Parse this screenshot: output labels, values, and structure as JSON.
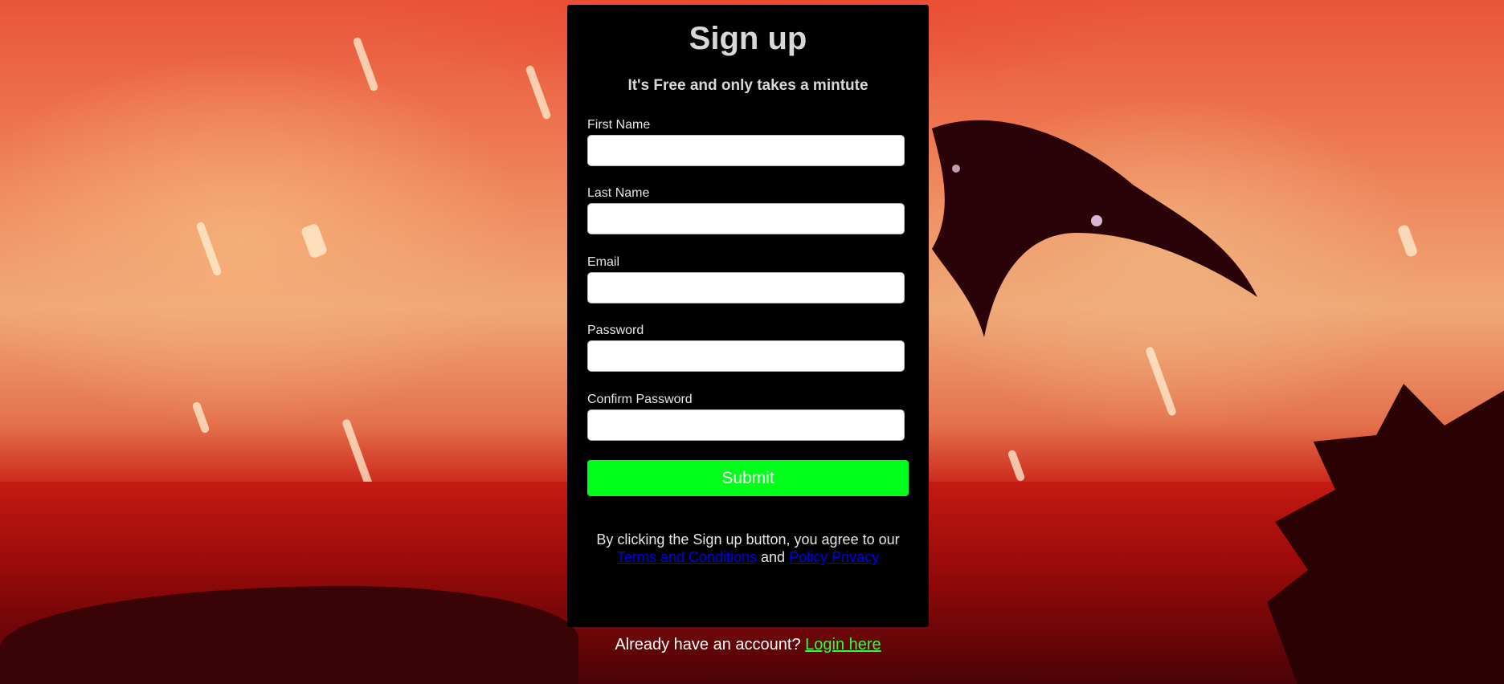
{
  "form": {
    "title": "Sign up",
    "subtitle": "It's Free and only takes a mintute",
    "fields": [
      {
        "label": "First Name",
        "value": "",
        "placeholder": ""
      },
      {
        "label": "Last Name",
        "value": "",
        "placeholder": ""
      },
      {
        "label": "Email",
        "value": "",
        "placeholder": ""
      },
      {
        "label": "Password",
        "value": "",
        "placeholder": ""
      },
      {
        "label": "Confirm Password",
        "value": "",
        "placeholder": ""
      }
    ],
    "submit_label": "Submit",
    "terms": {
      "prefix": "By clicking the Sign up button, you agree to our",
      "terms_link": "Terms and Conditions",
      "conjunction": "and",
      "privacy_link": "Policy Privacy"
    }
  },
  "footer": {
    "prompt": "Already have an account?",
    "login_link": "Login here"
  },
  "colors": {
    "card_background": "#000000",
    "submit_button": "#00ff1a",
    "login_link": "#2cff3a",
    "terms_link": "#0000ee"
  }
}
